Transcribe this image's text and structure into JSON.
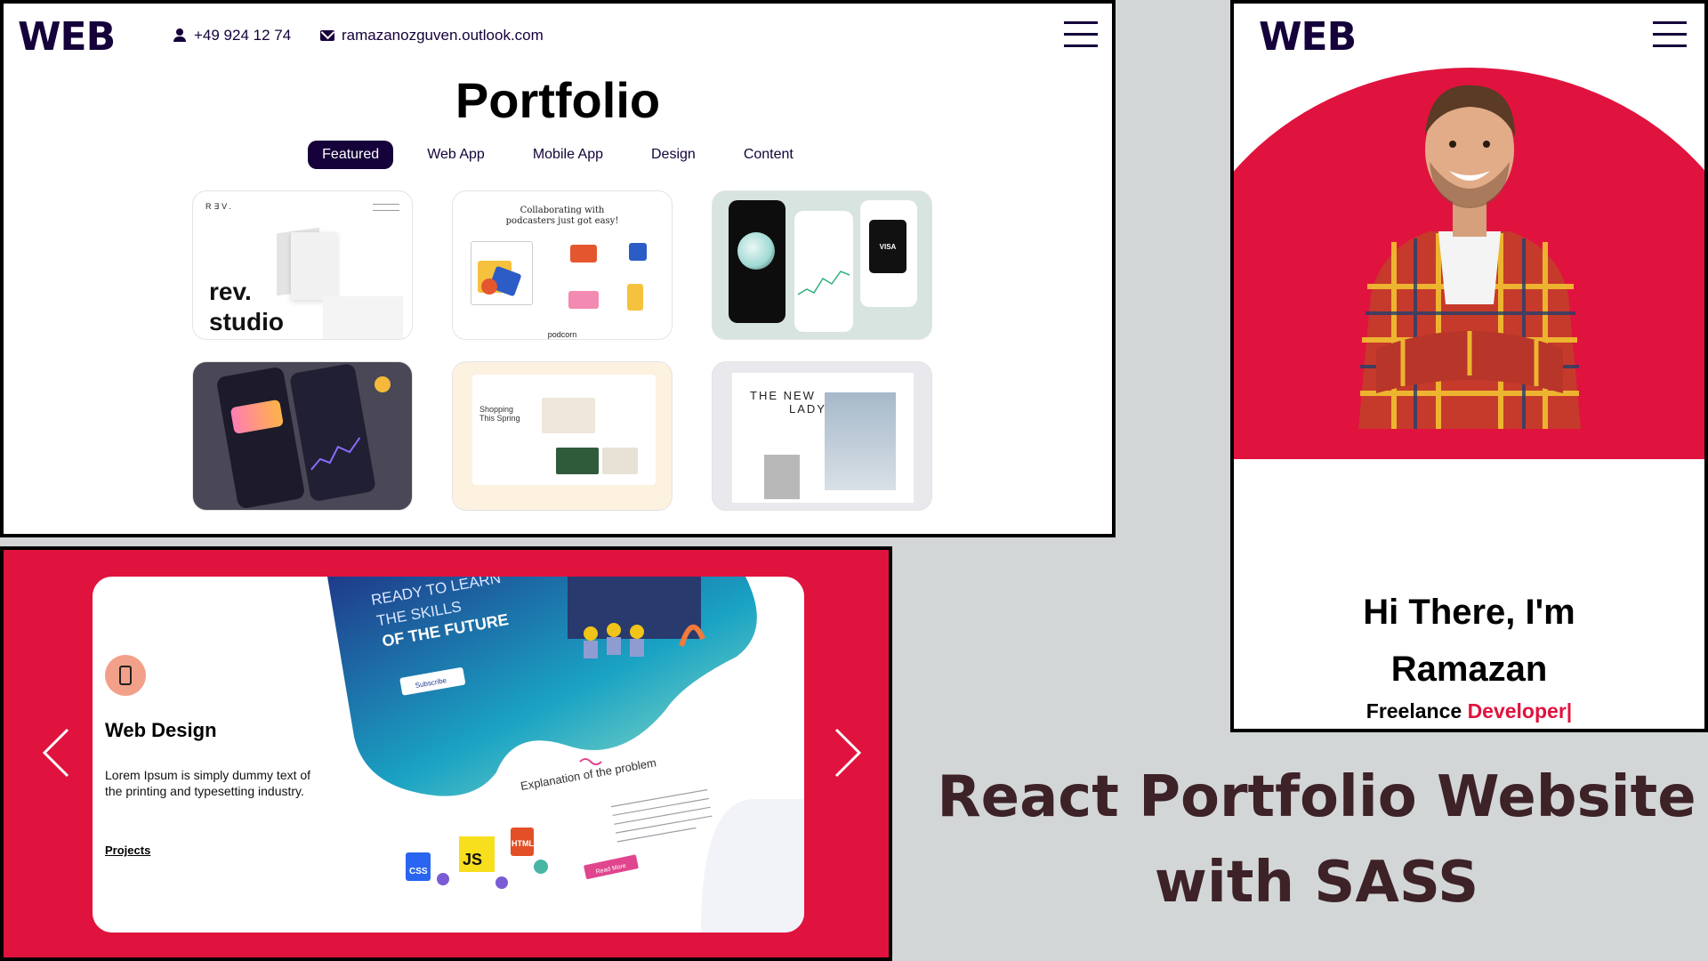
{
  "portfolio": {
    "logo": "WEB",
    "phone": "+49 924 12 74",
    "email": "ramazanozguven.outlook.com",
    "heading": "Portfolio",
    "tabs": [
      {
        "label": "Featured",
        "active": true
      },
      {
        "label": "Web App",
        "active": false
      },
      {
        "label": "Mobile App",
        "active": false
      },
      {
        "label": "Design",
        "active": false
      },
      {
        "label": "Content",
        "active": false
      }
    ],
    "cards": {
      "rev": {
        "brand": "R∃V.",
        "title_line1": "rev.",
        "title_line2": "studio"
      },
      "podcast": {
        "heading_line1": "Collaborating with",
        "heading_line2": "podcasters just got easy!",
        "footer": "podcorn"
      },
      "wallet": {
        "visa": "VISA"
      },
      "shopping": {
        "line1": "Shopping",
        "line2": "This Spring"
      },
      "lady": {
        "line1": "THE NEW",
        "line2": "LADY"
      }
    }
  },
  "profile": {
    "logo": "WEB",
    "greeting_line1": "Hi There, I'm",
    "greeting_line2": "Ramazan",
    "role_prefix": "Freelance",
    "role_accent": "Developer|"
  },
  "works": {
    "title": "Web Design",
    "description": "Lorem Ipsum is simply dummy text of the printing and typesetting industry.",
    "link_label": "Projects",
    "illustration": {
      "headline_line1": "READY TO LEARN",
      "headline_line2": "THE SKILLS",
      "headline_line3": "OF THE FUTURE",
      "button": "Subscribe",
      "explanation": "Explanation of the problem",
      "read_more": "Read More",
      "badges": [
        "CSS",
        "JS",
        "HTML"
      ]
    }
  },
  "caption": {
    "line1": "React Portfolio Website",
    "line2": "with SASS"
  },
  "colors": {
    "brand_navy": "#15023a",
    "accent_red": "#e0133e",
    "caption_text": "#3d2228",
    "background": "#d3d6d7"
  }
}
